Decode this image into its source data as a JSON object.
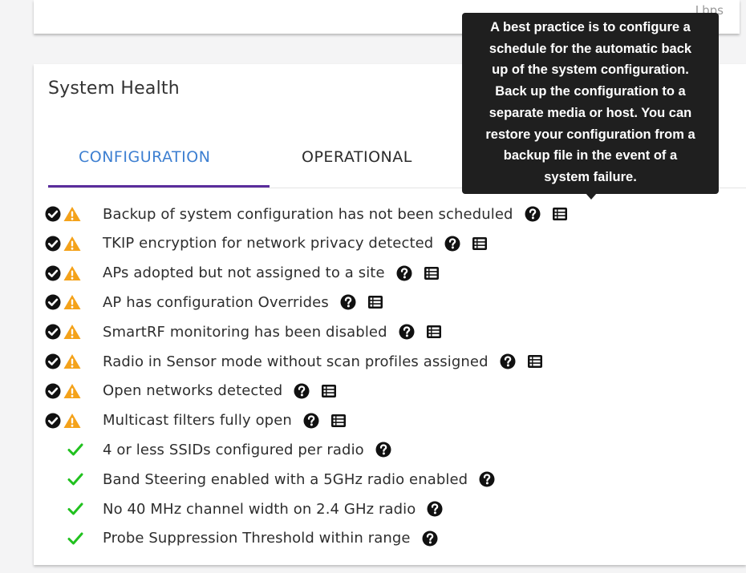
{
  "top_card": {
    "unit": "Lbps"
  },
  "panel": {
    "title": "System Health"
  },
  "tabs": [
    {
      "label": "CONFIGURATION",
      "active": true
    },
    {
      "label": "OPERATIONAL",
      "active": false
    }
  ],
  "tooltip": {
    "lines": [
      "A best practice is to configure a",
      "schedule for the automatic back",
      "up of the system configuration.",
      "Back up the configuration to a",
      "separate media or host. You can",
      "restore your configuration from a",
      "backup file in the event of a",
      "system failure."
    ]
  },
  "checks": [
    {
      "label": "Backup of system configuration has not been scheduled",
      "status": "warning",
      "has_details": true
    },
    {
      "label": "TKIP encryption for network privacy detected",
      "status": "warning",
      "has_details": true
    },
    {
      "label": "APs adopted but not assigned to a site",
      "status": "warning",
      "has_details": true
    },
    {
      "label": "AP has configuration Overrides",
      "status": "warning",
      "has_details": true
    },
    {
      "label": "SmartRF monitoring has been disabled",
      "status": "warning",
      "has_details": true
    },
    {
      "label": "Radio in Sensor mode without scan profiles assigned",
      "status": "warning",
      "has_details": true
    },
    {
      "label": "Open networks detected",
      "status": "warning",
      "has_details": true
    },
    {
      "label": "Multicast filters fully open",
      "status": "warning",
      "has_details": true
    },
    {
      "label": "4 or less SSIDs configured per radio",
      "status": "pass",
      "has_details": false
    },
    {
      "label": "Band Steering enabled with a 5GHz radio enabled",
      "status": "pass",
      "has_details": false
    },
    {
      "label": "No 40 MHz channel width on 2.4 GHz radio",
      "status": "pass",
      "has_details": false
    },
    {
      "label": "Probe Suppression Threshold within range",
      "status": "pass",
      "has_details": false
    }
  ],
  "colors": {
    "active_tab_text": "#3d7fd1",
    "active_tab_underline": "#5a2d9c",
    "warning": "#f4a21a",
    "pass": "#21c11f",
    "tooltip_bg": "#1f1f1f"
  },
  "icons": {
    "acknowledged": "check-circle-icon",
    "warning": "warning-triangle-icon",
    "pass": "checkmark-icon",
    "help": "question-circle-icon",
    "details": "list-icon"
  }
}
